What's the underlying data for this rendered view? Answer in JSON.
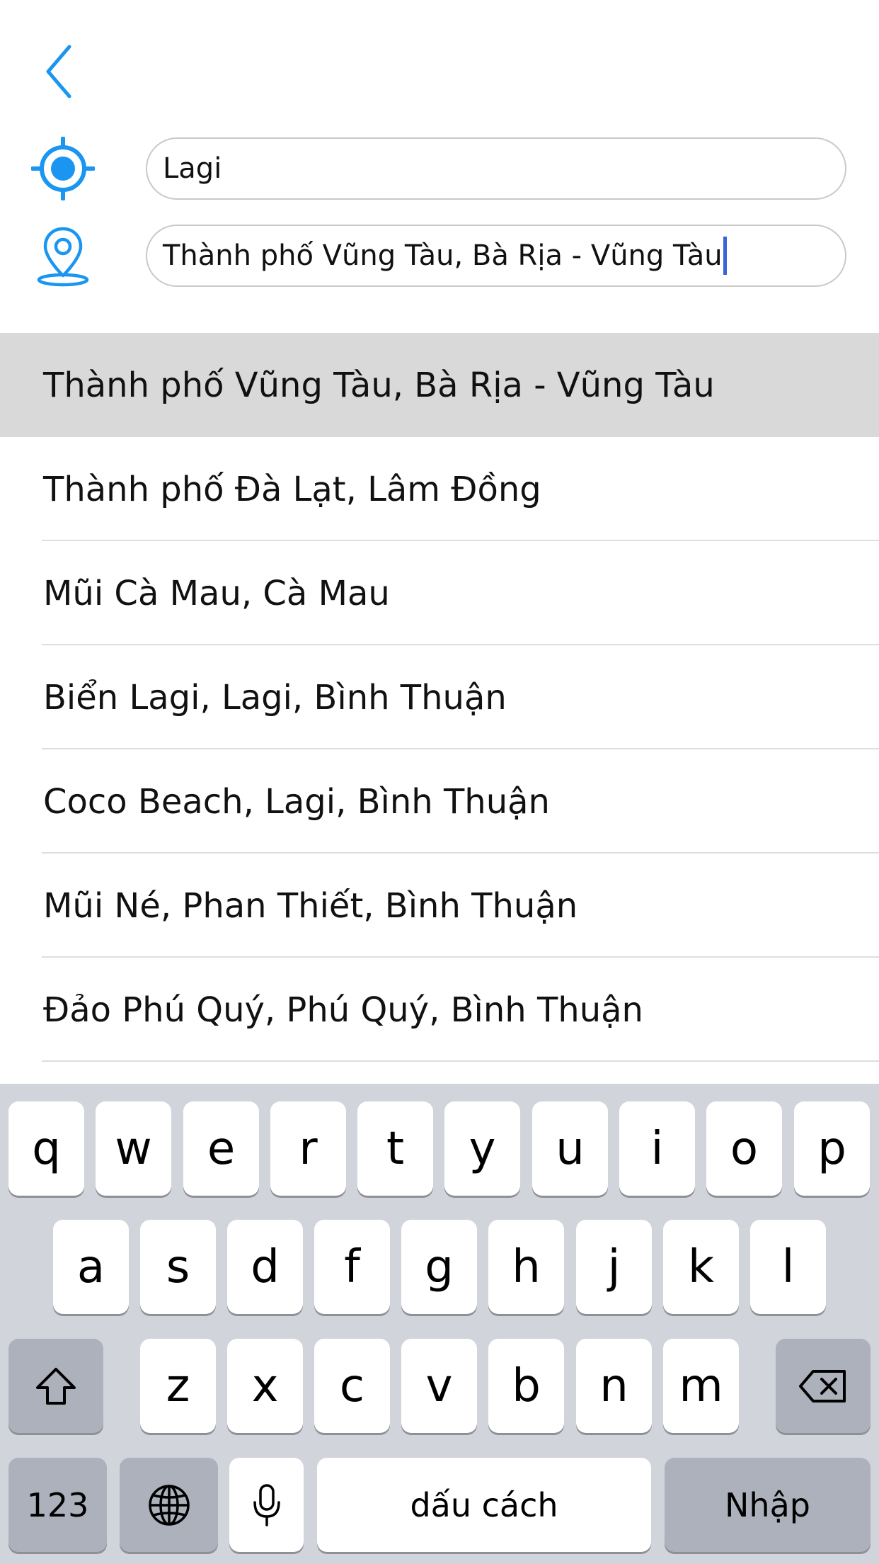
{
  "header": {
    "back_icon": "chevron-left-icon",
    "origin_icon": "crosshair-location-icon",
    "destination_icon": "map-pin-icon",
    "accent_color": "#1a96f0",
    "origin_value": "Lagi",
    "destination_value": "Thành phố Vũng Tàu, Bà Rịa - Vũng Tàu"
  },
  "results": [
    {
      "label": "Thành phố Vũng Tàu, Bà Rịa - Vũng Tàu",
      "selected": true
    },
    {
      "label": "Thành phố Đà Lạt, Lâm Đồng"
    },
    {
      "label": "Mũi Cà Mau, Cà Mau"
    },
    {
      "label": "Biển Lagi, Lagi, Bình Thuận"
    },
    {
      "label": "Coco Beach, Lagi, Bình Thuận"
    },
    {
      "label": "Mũi Né, Phan Thiết, Bình Thuận"
    },
    {
      "label": "Đảo Phú Quý, Phú Quý, Bình Thuận"
    }
  ],
  "keyboard": {
    "row1": [
      "q",
      "w",
      "e",
      "r",
      "t",
      "y",
      "u",
      "i",
      "o",
      "p"
    ],
    "row2": [
      "a",
      "s",
      "d",
      "f",
      "g",
      "h",
      "j",
      "k",
      "l"
    ],
    "row3": [
      "z",
      "x",
      "c",
      "v",
      "b",
      "n",
      "m"
    ],
    "shift_icon": "shift-arrow-icon",
    "delete_icon": "backspace-icon",
    "numbers_label": "123",
    "globe_icon": "globe-icon",
    "mic_icon": "microphone-icon",
    "space_label": "dấu cách",
    "return_label": "Nhập"
  }
}
